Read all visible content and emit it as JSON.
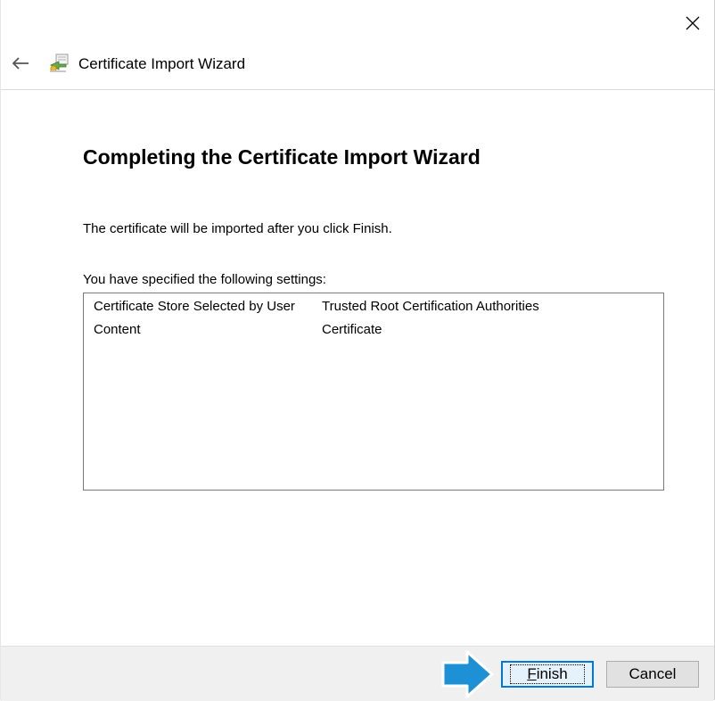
{
  "window": {
    "title": "Certificate Import Wizard",
    "close_icon": "close-icon",
    "back_icon": "back-arrow-icon",
    "wizard_icon": "certificate-icon"
  },
  "main": {
    "heading": "Completing the Certificate Import Wizard",
    "info_text": "The certificate will be imported after you click Finish.",
    "settings_label": "You have specified the following settings:",
    "settings": [
      {
        "key": "Certificate Store Selected by User",
        "value": "Trusted Root Certification Authorities"
      },
      {
        "key": "Content",
        "value": "Certificate"
      }
    ]
  },
  "footer": {
    "finish_label": "Finish",
    "finish_mnemonic": "F",
    "finish_rest": "inish",
    "cancel_label": "Cancel"
  },
  "colors": {
    "accent": "#0078d7",
    "arrow": "#1e90d6",
    "footer_bg": "#f0f0f0"
  }
}
